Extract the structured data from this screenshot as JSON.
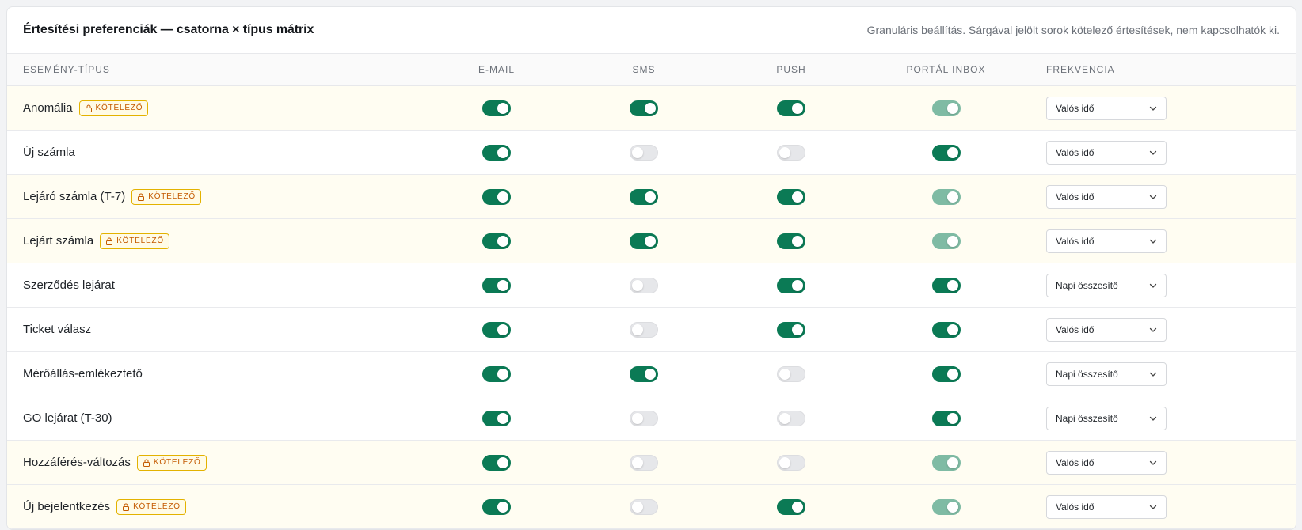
{
  "header": {
    "title": "Értesítési preferenciák — csatorna × típus mátrix",
    "subtitle": "Granuláris beállítás. Sárgával jelölt sorok kötelező értesítések, nem kapcsolhatók ki."
  },
  "columns": {
    "type": "ESEMÉNY-TÍPUS",
    "email": "E-MAIL",
    "sms": "SMS",
    "push": "PUSH",
    "inbox": "PORTÁL INBOX",
    "freq": "FREKVENCIA"
  },
  "badge_label": "KÖTELEZŐ",
  "colors": {
    "accent": "#0b7a55",
    "accent_locked": "#7fbba4",
    "mandatory_row_bg": "#fffdf2",
    "badge_text": "#c45a00"
  },
  "rows": [
    {
      "name": "Anomália",
      "mandatory": true,
      "email": true,
      "sms": true,
      "push": true,
      "inbox": true,
      "freq": "Valós idő"
    },
    {
      "name": "Új számla",
      "mandatory": false,
      "email": true,
      "sms": false,
      "push": false,
      "inbox": true,
      "freq": "Valós idő"
    },
    {
      "name": "Lejáró számla (T-7)",
      "mandatory": true,
      "email": true,
      "sms": true,
      "push": true,
      "inbox": true,
      "freq": "Valós idő"
    },
    {
      "name": "Lejárt számla",
      "mandatory": true,
      "email": true,
      "sms": true,
      "push": true,
      "inbox": true,
      "freq": "Valós idő"
    },
    {
      "name": "Szerződés lejárat",
      "mandatory": false,
      "email": true,
      "sms": false,
      "push": true,
      "inbox": true,
      "freq": "Napi összesítő"
    },
    {
      "name": "Ticket válasz",
      "mandatory": false,
      "email": true,
      "sms": false,
      "push": true,
      "inbox": true,
      "freq": "Valós idő"
    },
    {
      "name": "Mérőállás-emlékeztető",
      "mandatory": false,
      "email": true,
      "sms": true,
      "push": false,
      "inbox": true,
      "freq": "Napi összesítő"
    },
    {
      "name": "GO lejárat (T-30)",
      "mandatory": false,
      "email": true,
      "sms": false,
      "push": false,
      "inbox": true,
      "freq": "Napi összesítő"
    },
    {
      "name": "Hozzáférés-változás",
      "mandatory": true,
      "email": true,
      "sms": false,
      "push": false,
      "inbox": true,
      "freq": "Valós idő"
    },
    {
      "name": "Új bejelentkezés",
      "mandatory": true,
      "email": true,
      "sms": false,
      "push": true,
      "inbox": true,
      "freq": "Valós idő"
    }
  ]
}
